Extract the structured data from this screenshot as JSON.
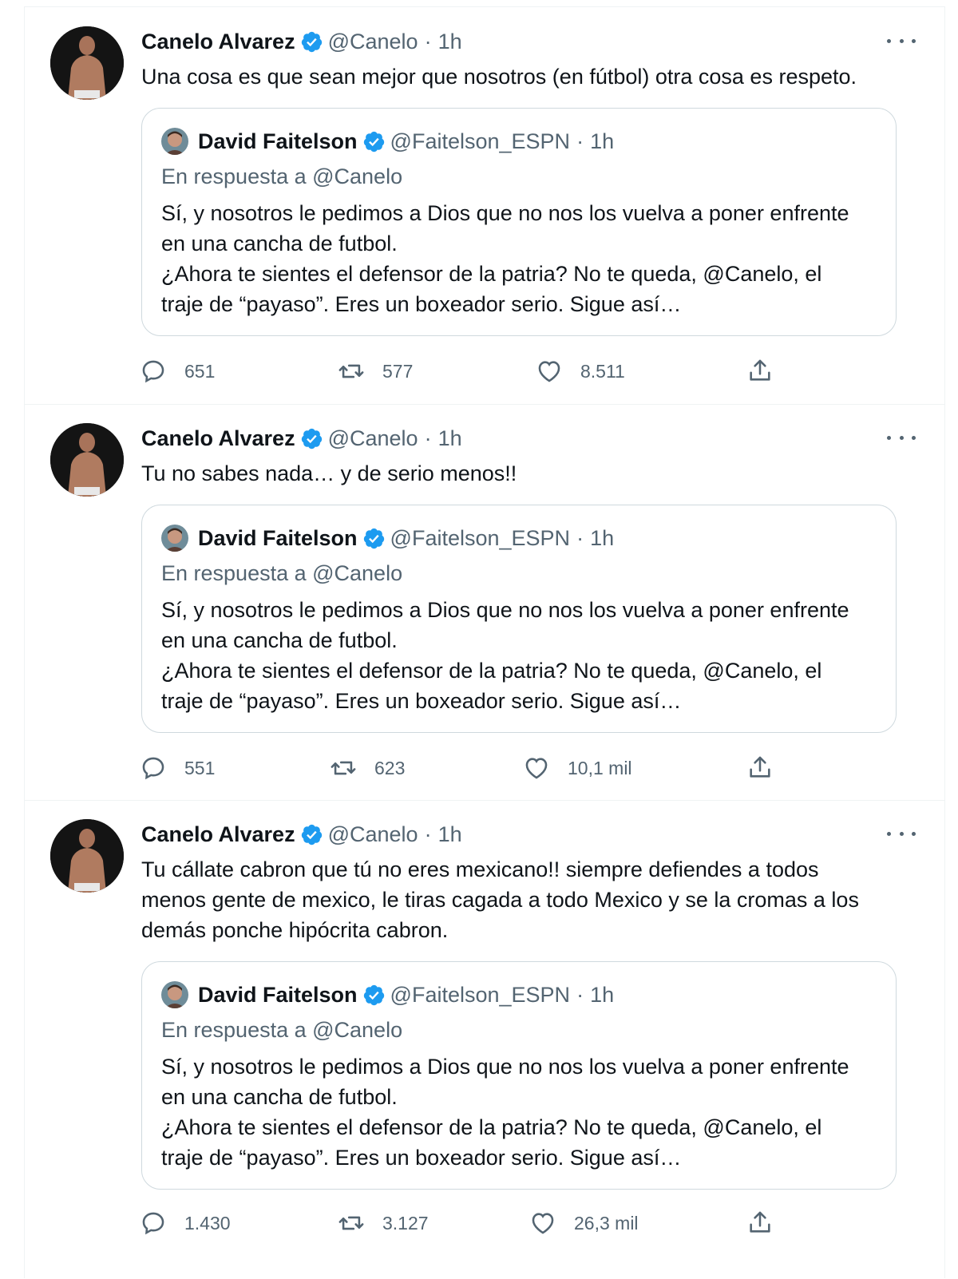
{
  "tweets": [
    {
      "author": {
        "name": "Canelo Alvarez",
        "handle": "@Canelo",
        "time": "1h"
      },
      "text_lines": [
        "Una cosa es que sean mejor que nosotros (en fútbol) otra cosa es respeto."
      ],
      "quote": {
        "author": {
          "name": "David Faitelson",
          "handle": "@Faitelson_ESPN",
          "time": "1h"
        },
        "reply_to": "En respuesta a @Canelo",
        "lines": [
          "Sí, y nosotros le pedimos a Dios que no nos los vuelva a poner enfrente",
          "en una cancha de futbol.",
          "¿Ahora te sientes el defensor de la patria? No te queda, @Canelo, el",
          "traje de “payaso”. Eres un boxeador serio. Sigue así…"
        ]
      },
      "stats": {
        "replies": "651",
        "retweets": "577",
        "likes": "8.511"
      }
    },
    {
      "author": {
        "name": "Canelo Alvarez",
        "handle": "@Canelo",
        "time": "1h"
      },
      "text_lines": [
        "Tu no sabes nada… y de serio menos!!"
      ],
      "quote": {
        "author": {
          "name": "David Faitelson",
          "handle": "@Faitelson_ESPN",
          "time": "1h"
        },
        "reply_to": "En respuesta a @Canelo",
        "lines": [
          "Sí, y nosotros le pedimos a Dios que no nos los vuelva a poner enfrente",
          "en una cancha de futbol.",
          "¿Ahora te sientes el defensor de la patria? No te queda, @Canelo, el",
          "traje de “payaso”. Eres un boxeador serio. Sigue así…"
        ]
      },
      "stats": {
        "replies": "551",
        "retweets": "623",
        "likes": "10,1 mil"
      }
    },
    {
      "author": {
        "name": "Canelo Alvarez",
        "handle": "@Canelo",
        "time": "1h"
      },
      "text_lines": [
        "Tu cállate cabron que tú no eres mexicano!! siempre defiendes a todos",
        "menos gente de mexico, le tiras cagada a todo Mexico y se la cromas a los",
        "demás ponche hipócrita cabron."
      ],
      "quote": {
        "author": {
          "name": "David Faitelson",
          "handle": "@Faitelson_ESPN",
          "time": "1h"
        },
        "reply_to": "En respuesta a @Canelo",
        "lines": [
          "Sí, y nosotros le pedimos a Dios que no nos los vuelva a poner enfrente",
          "en una cancha de futbol.",
          "¿Ahora te sientes el defensor de la patria? No te queda, @Canelo, el",
          "traje de “payaso”. Eres un boxeador serio. Sigue así…"
        ]
      },
      "stats": {
        "replies": "1.430",
        "retweets": "3.127",
        "likes": "26,3 mil"
      }
    }
  ],
  "separator": "·",
  "icons": {
    "verified": "verified-badge-icon",
    "reply": "reply-bubble-icon",
    "retweet": "retweet-icon",
    "like": "heart-icon",
    "share": "share-upload-icon",
    "more": "more-dots-icon"
  },
  "colors": {
    "text": "#0f1419",
    "secondary": "#536471",
    "verified": "#1d9bf0",
    "border": "#cfd9de"
  }
}
